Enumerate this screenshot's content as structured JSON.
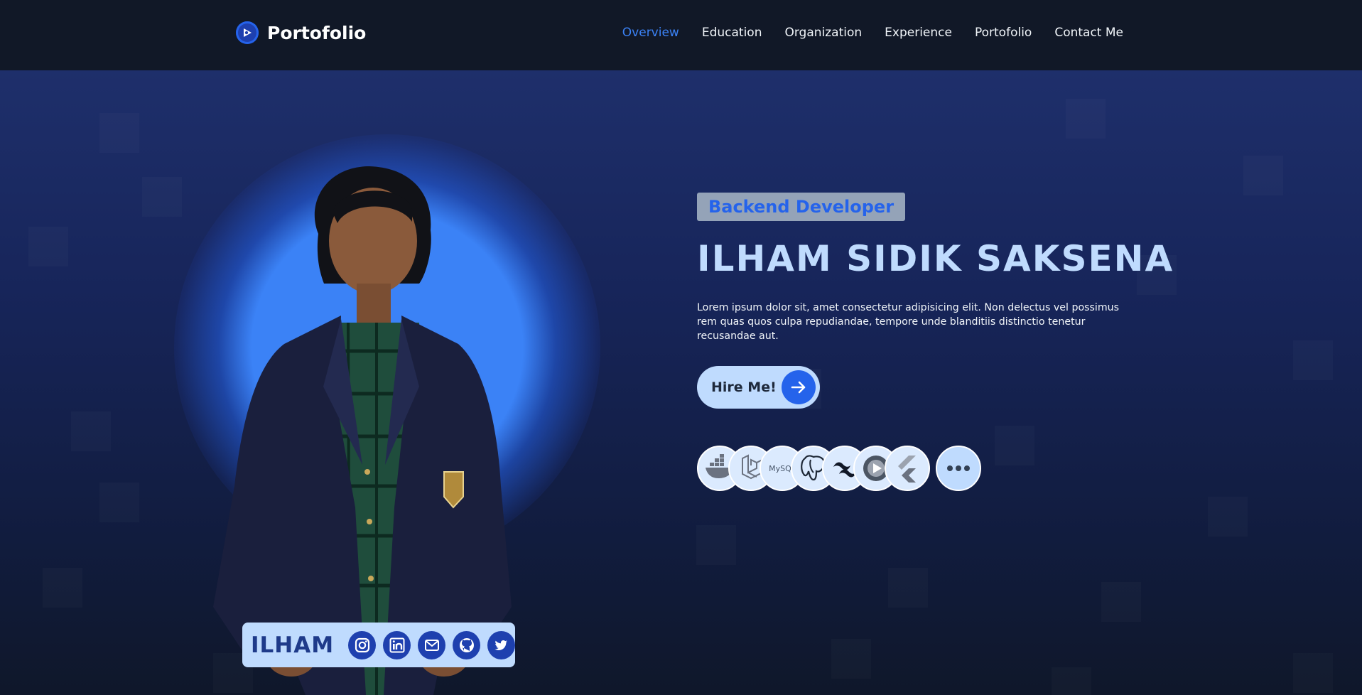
{
  "nav": {
    "brand": "Portofolio",
    "links": [
      {
        "label": "Overview",
        "active": true
      },
      {
        "label": "Education"
      },
      {
        "label": "Organization"
      },
      {
        "label": "Experience"
      },
      {
        "label": "Portofolio"
      },
      {
        "label": "Contact Me"
      }
    ]
  },
  "hero": {
    "role": "Backend Developer",
    "name": "ILHAM SIDIK SAKSENA",
    "description": "Lorem ipsum dolor sit, amet consectetur adipisicing elit. Non delectus vel possimus rem quas quos culpa repudiandae, tempore unde blanditiis distinctio tenetur recusandae aut.",
    "hire_label": "Hire Me!"
  },
  "tech_stack": [
    {
      "name": "docker-icon"
    },
    {
      "name": "laravel-icon"
    },
    {
      "name": "mysql-icon",
      "text": "MySQL"
    },
    {
      "name": "postgresql-icon"
    },
    {
      "name": "tailwind-icon"
    },
    {
      "name": "play-icon"
    },
    {
      "name": "flutter-icon"
    }
  ],
  "profile_card": {
    "nickname": "ILHAM",
    "socials": [
      "instagram-icon",
      "linkedin-icon",
      "mail-icon",
      "github-icon",
      "twitter-icon"
    ]
  },
  "colors": {
    "accent": "#2563eb",
    "nav_bg": "#111827",
    "light_blue": "#bfdbfe",
    "heading": "#bfdbfe"
  }
}
